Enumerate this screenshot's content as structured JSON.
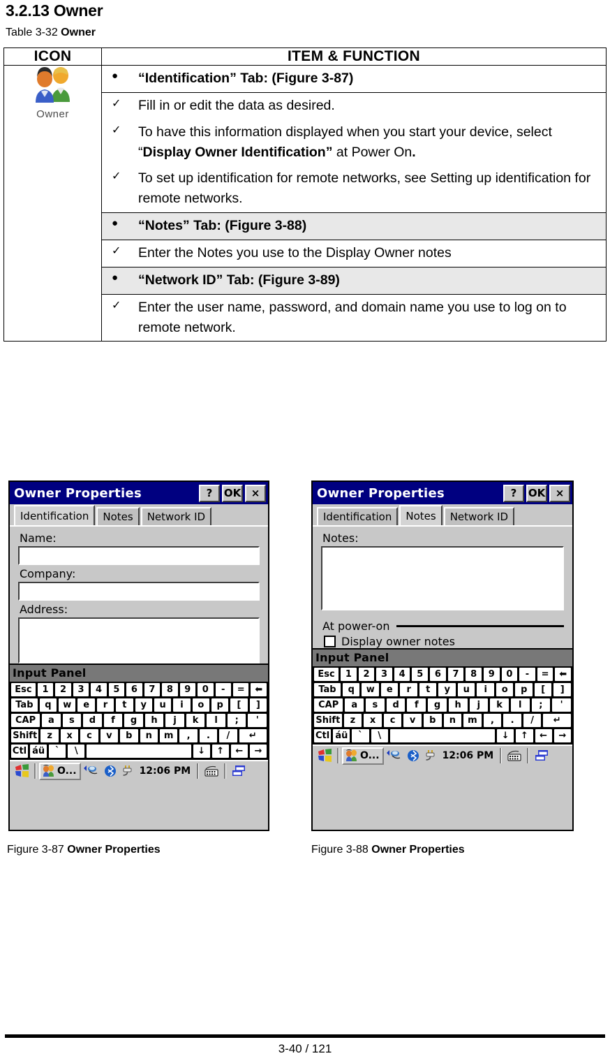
{
  "document": {
    "section_heading": "3.2.13 Owner",
    "table_caption_prefix": "Table 3-32 ",
    "table_caption_bold": "Owner",
    "footer_page": "3-40 / 121"
  },
  "table": {
    "headers": {
      "icon": "ICON",
      "item_function": "ITEM & FUNCTION"
    },
    "icon_cell": {
      "icon_name": "owner-users-icon",
      "label": "Owner"
    },
    "bullet_marker": "●",
    "check_marker": "✓",
    "rows": [
      {
        "type": "head",
        "marker": "●",
        "parts": [
          {
            "text": "“Identification” Tab: (Figure 3-87)",
            "bold": true
          }
        ]
      },
      {
        "type": "item",
        "marker": "✓",
        "parts": [
          {
            "text": "Fill in or edit the data as desired.",
            "bold": false
          }
        ]
      },
      {
        "type": "item",
        "marker": "✓",
        "parts": [
          {
            "text": "To have this information displayed when you start your device, select “",
            "bold": false
          },
          {
            "text": "Display Owner Identification”",
            "bold": true
          },
          {
            "text": " at Power On",
            "bold": false
          },
          {
            "text": ".",
            "bold": true
          }
        ]
      },
      {
        "type": "item",
        "marker": "✓",
        "parts": [
          {
            "text": "To set up identification for remote networks, see Setting up identification for remote networks.",
            "bold": false
          }
        ]
      },
      {
        "type": "head",
        "marker": "●",
        "parts": [
          {
            "text": "“Notes” Tab: (Figure 3-88)",
            "bold": true
          }
        ]
      },
      {
        "type": "item",
        "marker": "✓",
        "parts": [
          {
            "text": "Enter the Notes you use to the Display Owner notes",
            "bold": false
          }
        ]
      },
      {
        "type": "head",
        "marker": "●",
        "parts": [
          {
            "text": "“Network ID” Tab: (Figure 3-89)",
            "bold": true
          }
        ]
      },
      {
        "type": "item",
        "marker": "✓",
        "parts": [
          {
            "text": "Enter the user name, password, and domain name you use to log on to remote network.",
            "bold": false
          }
        ]
      }
    ]
  },
  "screenshot_left": {
    "window_title": "Owner Properties",
    "titlebar_buttons": [
      {
        "icon": "help-icon",
        "label": "?"
      },
      {
        "icon": "ok-icon",
        "label": "OK"
      },
      {
        "icon": "close-icon",
        "label": "×"
      }
    ],
    "tabs": [
      {
        "label": "Identification",
        "active": true
      },
      {
        "label": "Notes",
        "active": false
      },
      {
        "label": "Network ID",
        "active": false
      }
    ],
    "fields": [
      {
        "label": "Name:",
        "value": "",
        "size": "small"
      },
      {
        "label": "Company:",
        "value": "",
        "size": "small"
      },
      {
        "label": "Address:",
        "value": "",
        "size": "large"
      }
    ],
    "input_panel_title": "Input Panel",
    "taskbar": {
      "start_icon": "windows-start-icon",
      "task_label": "O...",
      "task_icon": "owner-users-icon",
      "tray_icons": [
        "network-icon",
        "bluetooth-icon",
        "power-plug-icon"
      ],
      "time": "12:06 PM",
      "right_icons": [
        "keyboard-icon",
        "windows-stack-icon"
      ]
    }
  },
  "screenshot_right": {
    "window_title": "Owner Properties",
    "titlebar_buttons": [
      {
        "icon": "help-icon",
        "label": "?"
      },
      {
        "icon": "ok-icon",
        "label": "OK"
      },
      {
        "icon": "close-icon",
        "label": "×"
      }
    ],
    "tabs": [
      {
        "label": "Identification",
        "active": false
      },
      {
        "label": "Notes",
        "active": true
      },
      {
        "label": "Network ID",
        "active": false
      }
    ],
    "notes_label": "Notes:",
    "notes_value": "",
    "group_label": "At power-on",
    "checkbox_label": "Display owner notes",
    "checkbox_checked": false,
    "input_panel_title": "Input Panel",
    "taskbar": {
      "start_icon": "windows-start-icon",
      "task_label": "O...",
      "task_icon": "owner-users-icon",
      "tray_icons": [
        "network-icon",
        "bluetooth-icon",
        "power-plug-icon"
      ],
      "time": "12:06 PM",
      "right_icons": [
        "keyboard-icon",
        "windows-stack-icon"
      ]
    }
  },
  "keyboard": {
    "rows": [
      [
        "Esc",
        "1",
        "2",
        "3",
        "4",
        "5",
        "6",
        "7",
        "8",
        "9",
        "0",
        "-",
        "=",
        "⬅"
      ],
      [
        "Tab",
        "q",
        "w",
        "e",
        "r",
        "t",
        "y",
        "u",
        "i",
        "o",
        "p",
        "[",
        "]"
      ],
      [
        "CAP",
        "a",
        "s",
        "d",
        "f",
        "g",
        "h",
        "j",
        "k",
        "l",
        ";",
        "'"
      ],
      [
        "Shift",
        "z",
        "x",
        "c",
        "v",
        "b",
        "n",
        "m",
        ",",
        ".",
        "/",
        "↵"
      ],
      [
        "Ctl",
        "áü",
        "`",
        "\\",
        " ",
        "↓",
        "↑",
        "←",
        "→"
      ]
    ]
  },
  "figures": [
    {
      "number": "Figure 3-87 ",
      "title": "Owner Properties"
    },
    {
      "number": "Figure 3-88 ",
      "title": "Owner Properties"
    }
  ],
  "colors": {
    "titlebar": "#000080",
    "window_face": "#c8c8c8",
    "shaded_row": "#e8e8e8",
    "input_panel_bar": "#787878"
  }
}
